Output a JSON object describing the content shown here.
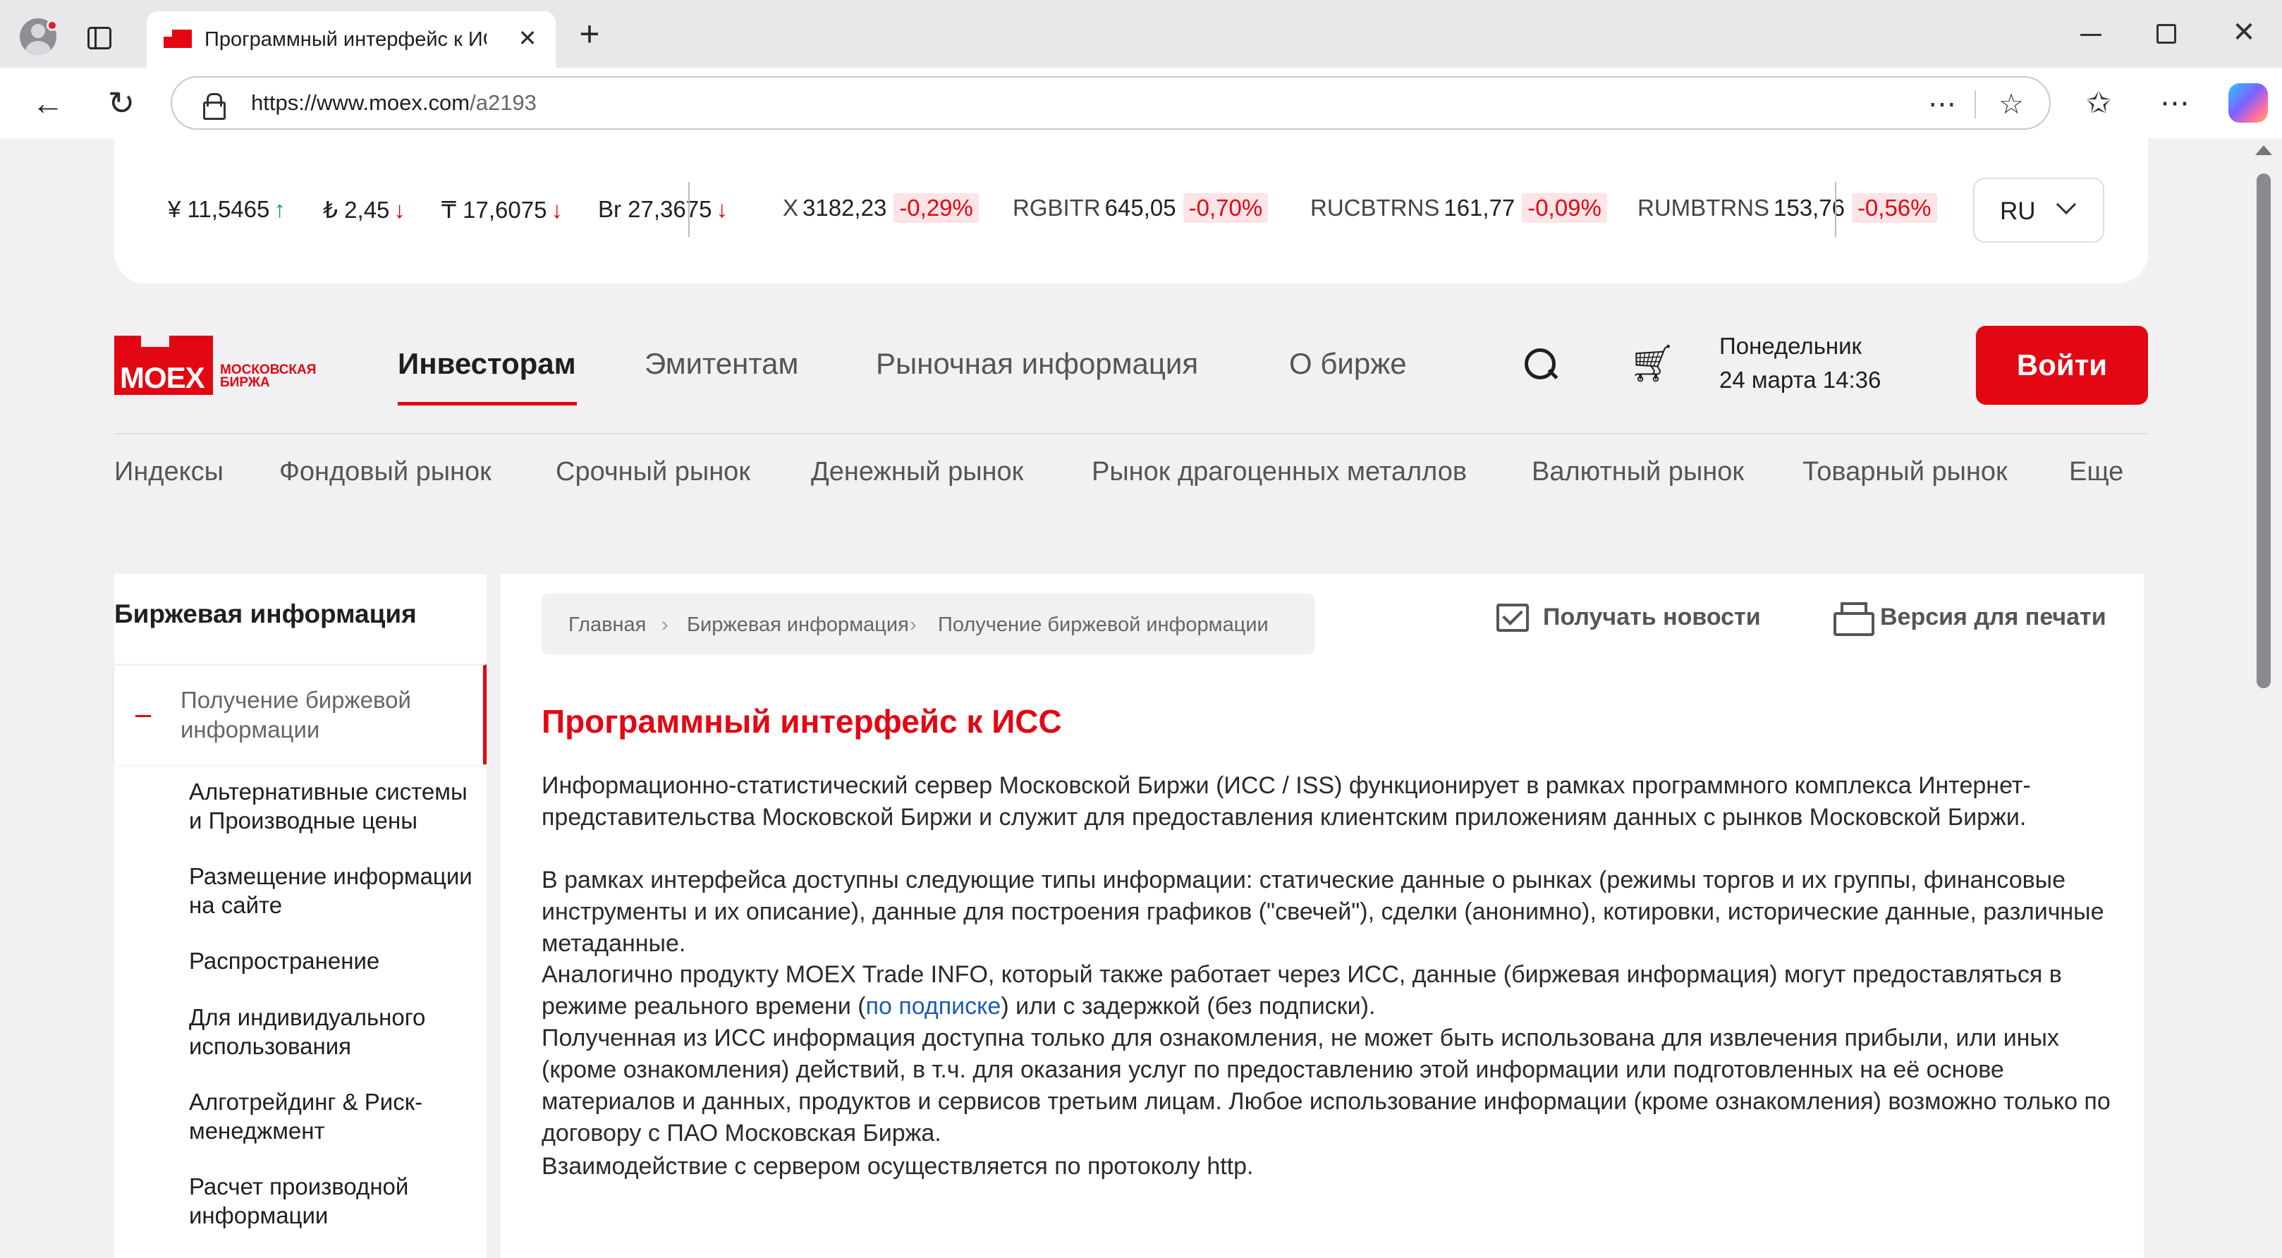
{
  "browser": {
    "tab_title": "Программный интерфейс к ИСС",
    "url_host": "https://www.moex.com",
    "url_path": "/a2193"
  },
  "ticker": {
    "currencies": [
      {
        "symbol": "¥",
        "value": "11,5465",
        "direction": "up"
      },
      {
        "symbol": "₺",
        "value": "2,45",
        "direction": "down"
      },
      {
        "symbol": "₸",
        "value": "17,6075",
        "direction": "down"
      },
      {
        "symbol": "Br",
        "value": "27,3675",
        "direction": "down"
      }
    ],
    "indices": [
      {
        "name": "X",
        "value": "3182,23",
        "change": "-0,29%"
      },
      {
        "name": "RGBITR",
        "value": "645,05",
        "change": "-0,70%"
      },
      {
        "name": "RUCBTRNS",
        "value": "161,77",
        "change": "-0,09%"
      },
      {
        "name": "RUMBTRNS",
        "value": "153,76",
        "change": "-0,56%"
      }
    ],
    "language": "RU"
  },
  "header": {
    "logo_text": "MOEX",
    "logo_sub_line1": "МОСКОВСКАЯ",
    "logo_sub_line2": "БИРЖА",
    "nav": [
      "Инвесторам",
      "Эмитентам",
      "Рыночная информация",
      "О бирже"
    ],
    "date_line1": "Понедельник",
    "date_line2": "24 марта 14:36",
    "login_label": "Войти"
  },
  "subnav": [
    "Индексы",
    "Фондовый рынок",
    "Срочный рынок",
    "Денежный рынок",
    "Рынок драгоценных металлов",
    "Валютный рынок",
    "Товарный рынок",
    "Еще"
  ],
  "sidebar": {
    "title": "Биржевая информация",
    "active_item": "Получение биржевой информации",
    "items": [
      "Альтернативные системы и Производные цены",
      "Размещение информации на сайте",
      "Распространение",
      "Для индивидуального использования",
      "Алготрейдинг & Риск-менеджмент",
      "Расчет производной информации"
    ]
  },
  "breadcrumb": [
    "Главная",
    "Биржевая информация",
    "Получение биржевой информации"
  ],
  "actions": {
    "subscribe": "Получать новости",
    "print": "Версия для печати"
  },
  "content": {
    "title": "Программный интерфейс к ИСС",
    "p1": "Информационно-статистический сервер Московской Биржи (ИСС / ISS) функционирует в рамках программного комплекса Интернет-представительства Московской Биржи и служит для предоставления клиентским приложениям данных с рынков Московской Биржи.",
    "p2": "В рамках интерфейса доступны следующие типы информации: статические данные о рынках (режимы торгов и их группы, финансовые инструменты и их описание), данные для построения графиков (\"свечей\"), сделки (анонимно), котировки, исторические данные, различные метаданные.",
    "p3_before": "Аналогично продукту MOEX Trade INFO, который также работает через ИСС, данные (биржевая информация) могут предоставляться в режиме реального времени (",
    "p3_link": "по подписке",
    "p3_after": ") или с задержкой (без подписки).",
    "p4": "Полученная из ИСС информация доступна только для ознакомления, не может быть использована для извлечения прибыли, или иных (кроме ознакомления) действий, в т.ч. для оказания услуг по предоставлению этой информации или подготовленных на её основе материалов и данных, продуктов и сервисов третьим лицам. Любое использование информации (кроме ознакомления) возможно только по договору с ПАО Московская Биржа.",
    "p5": "Взаимодействие с сервером осуществляется по протоколу http."
  },
  "colors": {
    "brand_red": "#e30613",
    "link_blue": "#1d5bb5",
    "up_green": "#1a9e3a"
  }
}
